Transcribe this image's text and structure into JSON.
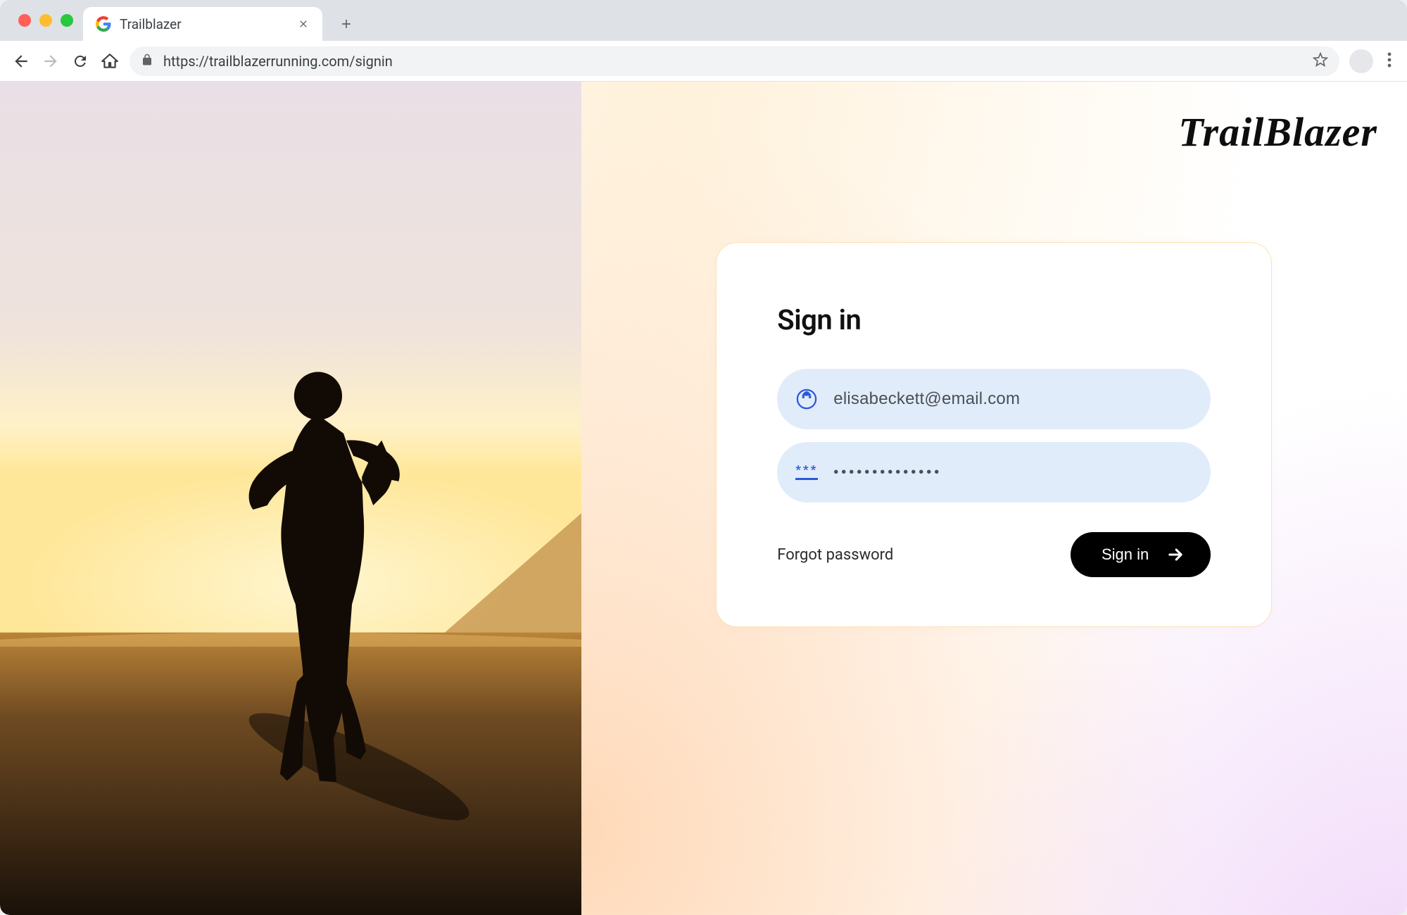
{
  "browser": {
    "tab_title": "Trailblazer",
    "url": "https://trailblazerrunning.com/signin"
  },
  "page": {
    "brand": "TrailBlazer",
    "card": {
      "heading": "Sign in",
      "email_value": "elisabeckett@email.com",
      "password_value": "••••••••••••••",
      "forgot_label": "Forgot password",
      "submit_label": "Sign in"
    }
  }
}
